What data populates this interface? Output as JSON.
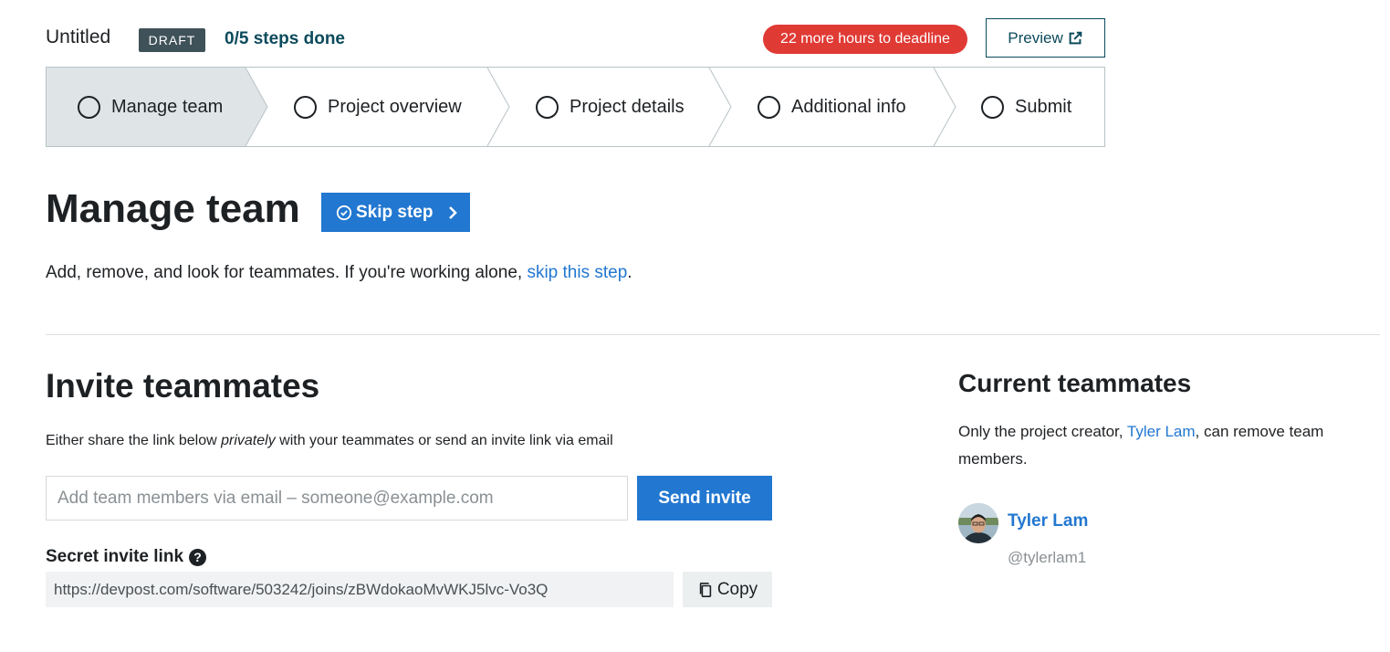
{
  "header": {
    "title": "Untitled",
    "badge": "DRAFT",
    "progress": "0/5 steps done",
    "deadline": "22 more hours to deadline",
    "preview_label": "Preview"
  },
  "steps": [
    {
      "label": "Manage team",
      "active": true
    },
    {
      "label": "Project overview",
      "active": false
    },
    {
      "label": "Project details",
      "active": false
    },
    {
      "label": "Additional info",
      "active": false
    },
    {
      "label": "Submit",
      "active": false
    }
  ],
  "main": {
    "title": "Manage team",
    "skip_label": "Skip step",
    "intro_text": "Add, remove, and look for teammates. If you're working alone, ",
    "intro_link": "skip this step",
    "intro_end": "."
  },
  "invite": {
    "title": "Invite teammates",
    "desc_before": "Either share the link below ",
    "desc_em": "privately",
    "desc_after": " with your teammates or send an invite link via email",
    "email_placeholder": "Add team members via email – someone@example.com",
    "send_label": "Send invite",
    "secret_label": "Secret invite link",
    "secret_url": "https://devpost.com/software/503242/joins/zBWdokaoMvWKJ5lvc-Vo3Q",
    "copy_label": "Copy"
  },
  "teammates": {
    "title": "Current teammates",
    "desc_before": "Only the project creator, ",
    "desc_link": "Tyler Lam",
    "desc_after": ", can remove team members.",
    "members": [
      {
        "name": "Tyler Lam",
        "handle": "@tylerlam1"
      }
    ]
  },
  "colors": {
    "accent": "#2277d0",
    "badge": "#3f5159",
    "deadline": "#e03a34",
    "active_step": "#dfe5e7"
  }
}
